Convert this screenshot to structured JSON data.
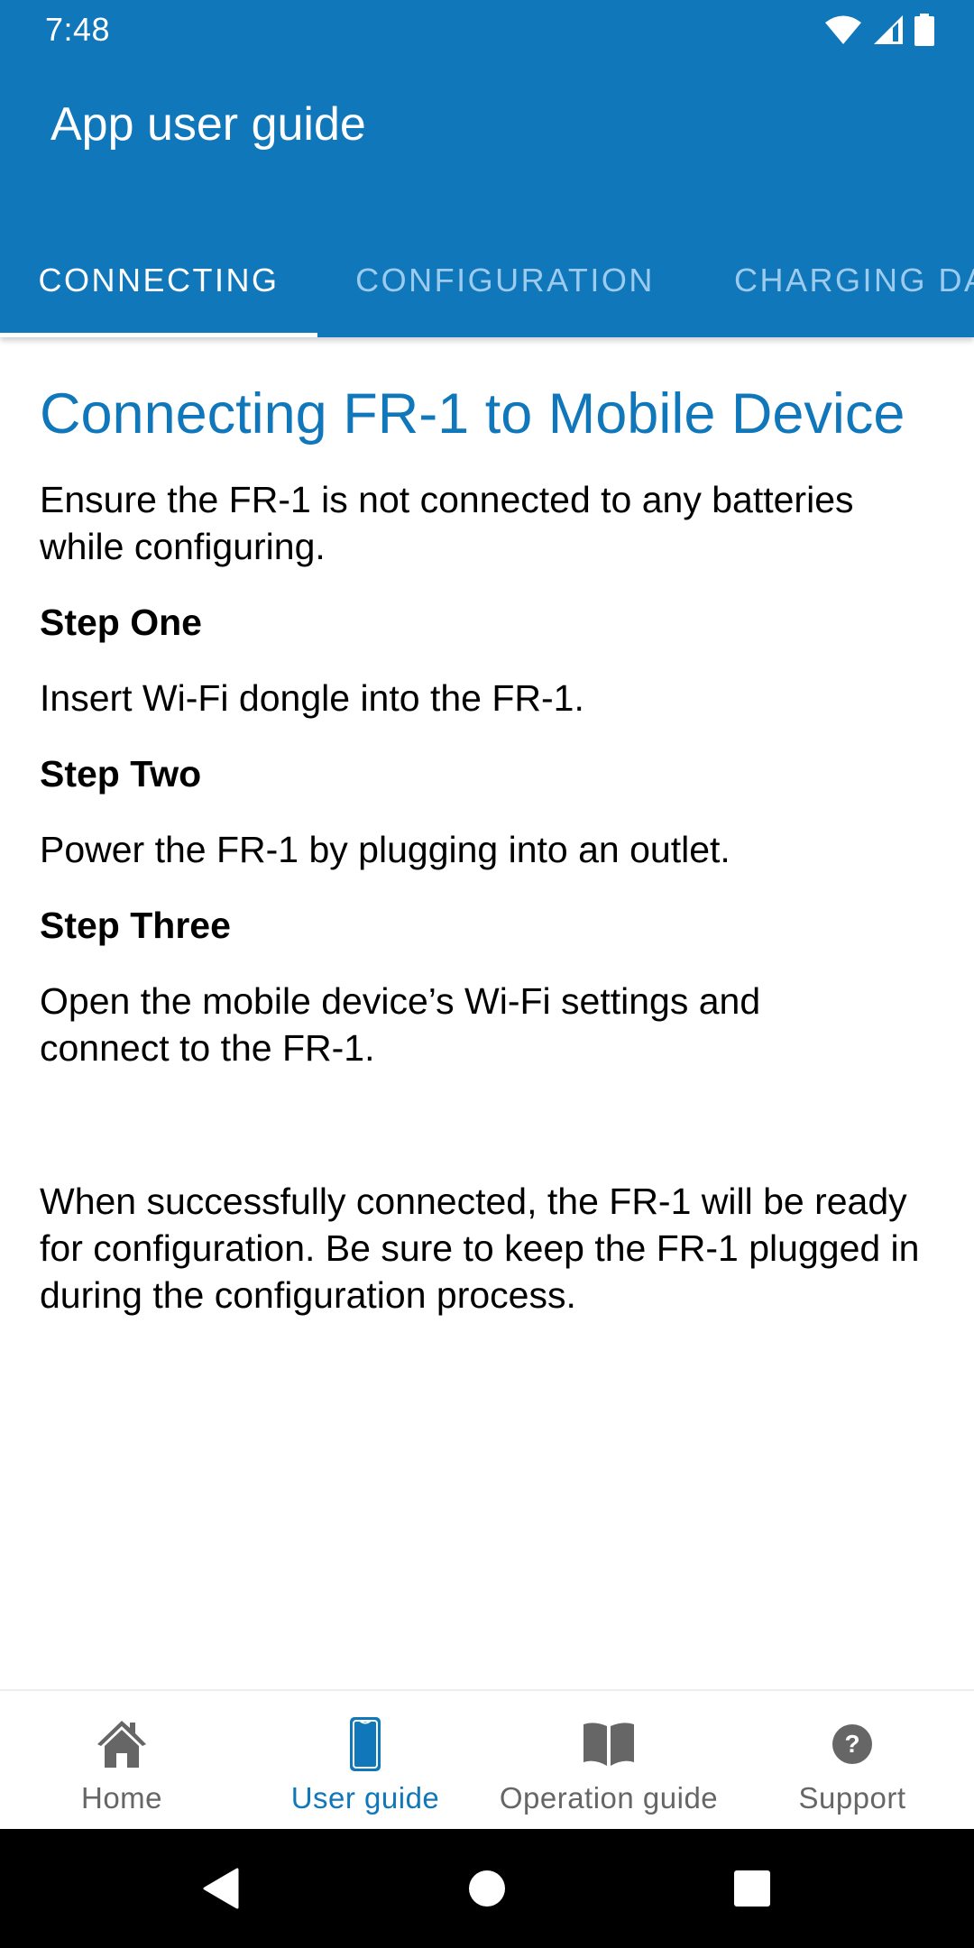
{
  "status_bar": {
    "time": "7:48",
    "icons": [
      "wifi-icon",
      "cell-signal-icon",
      "battery-icon"
    ]
  },
  "app_bar": {
    "title": "App user guide"
  },
  "tabs": [
    {
      "label": "CONNECTING",
      "active": true
    },
    {
      "label": "CONFIGURATION",
      "active": false
    },
    {
      "label": "CHARGING DATA",
      "active": false
    }
  ],
  "content": {
    "heading": "Connecting FR-1 to Mobile Device",
    "intro": "Ensure the FR-1 is not connected to any batteries while configuring.",
    "steps": [
      {
        "title": "Step One",
        "text": "Insert Wi-Fi dongle into the FR-1."
      },
      {
        "title": "Step Two",
        "text": "Power the FR-1 by plugging into an outlet."
      },
      {
        "title": "Step Three",
        "text": "Open the mobile device’s Wi-Fi settings and connect to the FR-1."
      }
    ],
    "closing": "When successfully connected, the FR-1 will be ready for configuration. Be sure to keep the FR-1 plugged in during the configuration process."
  },
  "bottom_nav": [
    {
      "label": "Home",
      "icon": "home-icon",
      "active": false
    },
    {
      "label": "User guide",
      "icon": "phone-icon",
      "active": true
    },
    {
      "label": "Operation guide",
      "icon": "book-icon",
      "active": false
    },
    {
      "label": "Support",
      "icon": "help-circle-icon",
      "active": false
    }
  ],
  "system_nav": [
    "back-icon",
    "home-circle-icon",
    "recents-icon"
  ],
  "colors": {
    "primary": "#1077bb",
    "tab_inactive": "#9ccbee",
    "nav_inactive": "#666666",
    "text": "#000000"
  }
}
